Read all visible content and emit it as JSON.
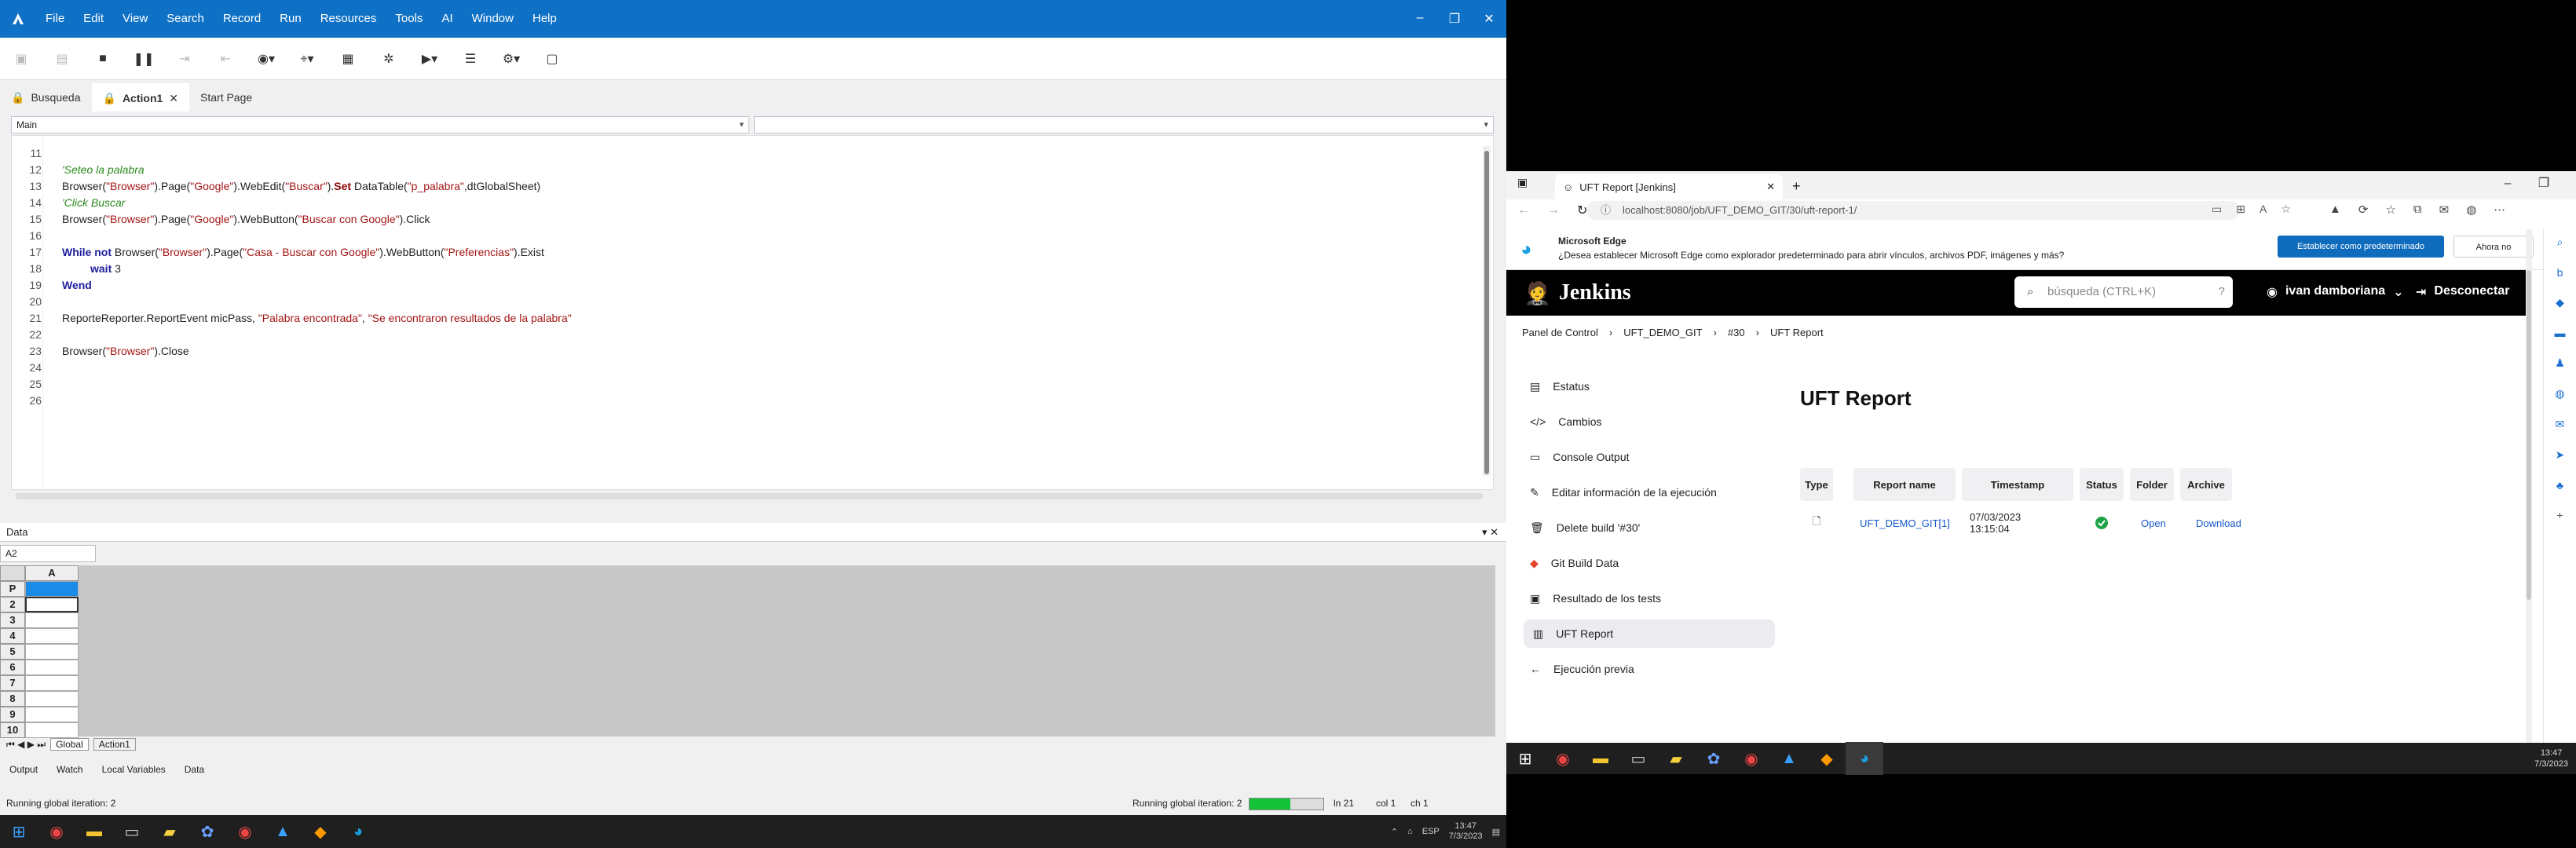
{
  "uft": {
    "menu": [
      "File",
      "Edit",
      "View",
      "Search",
      "Record",
      "Run",
      "Resources",
      "Tools",
      "AI",
      "Window",
      "Help"
    ],
    "tabs": [
      {
        "label": "Busqueda",
        "icon": "lock-icon"
      },
      {
        "label": "Action1",
        "icon": "lock-icon"
      },
      {
        "label": "Start Page",
        "icon": ""
      }
    ],
    "combo_left": "Main",
    "combo_right": "",
    "code_lines": [
      {
        "n": "11",
        "text": ""
      },
      {
        "n": "12",
        "text": "'Seteo la palabra"
      },
      {
        "n": "13",
        "text": "Browser(\"Browser\").Page(\"Google\").WebEdit(\"Buscar\").Set DataTable(\"p_palabra\",dtGlobalSheet)"
      },
      {
        "n": "14",
        "text": "'Click Buscar"
      },
      {
        "n": "15",
        "text": "Browser(\"Browser\").Page(\"Google\").WebButton(\"Buscar con Google\").Click"
      },
      {
        "n": "16",
        "text": ""
      },
      {
        "n": "17",
        "text": "While not Browser(\"Browser\").Page(\"Casa - Buscar con Google\").WebButton(\"Preferencias\").Exist"
      },
      {
        "n": "18",
        "text": "wait 3"
      },
      {
        "n": "19",
        "text": "Wend"
      },
      {
        "n": "20",
        "text": ""
      },
      {
        "n": "21",
        "text": "ReporteReporter.ReportEvent micPass, \"Palabra encontrada\", \"Se encontraron resultados de la palabra\""
      },
      {
        "n": "22",
        "text": ""
      },
      {
        "n": "23",
        "text": "Browser(\"Browser\").Close"
      },
      {
        "n": "24",
        "text": ""
      },
      {
        "n": "25",
        "text": ""
      },
      {
        "n": "26",
        "text": ""
      }
    ],
    "data_panel_title": "Data",
    "cell_ref": "A2",
    "grid_col": "A",
    "grid_rows": [
      "P",
      "2",
      "3",
      "4",
      "5",
      "6",
      "7",
      "8",
      "9",
      "10"
    ],
    "sheet_tabs": [
      "Global",
      "Action1"
    ],
    "bottom_tabs": [
      "Output",
      "Watch",
      "Local Variables",
      "Data"
    ],
    "status_left": "Running global iteration: 2",
    "status_right": "Running global iteration: 2",
    "status_progress": 0.55,
    "status_ln": "ln 21",
    "status_col": "col 1",
    "status_ch": "ch 1",
    "taskbar_time": "13:47",
    "taskbar_date": "7/3/2023",
    "taskbar_lang": "ESP"
  },
  "edge": {
    "tab_title": "UFT Report [Jenkins]",
    "url": "localhost:8080/job/UFT_DEMO_GIT/30/uft-report-1/",
    "banner_title": "Microsoft Edge",
    "banner_text": "¿Desea establecer Microsoft Edge como explorador predeterminado para abrir vínculos, archivos PDF, imágenes y más?",
    "banner_primary": "Establecer como predeterminado",
    "banner_secondary": "Ahora no"
  },
  "jenkins": {
    "brand": "Jenkins",
    "search_placeholder": "búsqueda (CTRL+K)",
    "user": "ivan damboriana",
    "logout": "Desconectar",
    "breadcrumbs": [
      "Panel de Control",
      "UFT_DEMO_GIT",
      "#30",
      "UFT Report"
    ],
    "nav": [
      {
        "label": "Estatus",
        "icon": "document-icon"
      },
      {
        "label": "Cambios",
        "icon": "code-icon"
      },
      {
        "label": "Console Output",
        "icon": "terminal-icon"
      },
      {
        "label": "Editar información de la ejecución",
        "icon": "edit-icon"
      },
      {
        "label": "Delete build '#30'",
        "icon": "trash-icon"
      },
      {
        "label": "Git Build Data",
        "icon": "git-icon"
      },
      {
        "label": "Resultado de los tests",
        "icon": "clipboard-icon"
      },
      {
        "label": "UFT Report",
        "icon": "report-icon"
      },
      {
        "label": "Ejecución previa",
        "icon": "arrow-left-icon"
      }
    ],
    "report_title": "UFT Report",
    "table_headers": [
      "Type",
      "Report name",
      "Timestamp",
      "Status",
      "Folder",
      "Archive"
    ],
    "row": {
      "report_name": "UFT_DEMO_GIT[1]",
      "timestamp": "07/03/2023 13:15:04",
      "folder": "Open",
      "archive": "Download"
    },
    "status_color": "#1ea446"
  },
  "taskbar2": {
    "time": "13:47",
    "date": "7/3/2023"
  }
}
